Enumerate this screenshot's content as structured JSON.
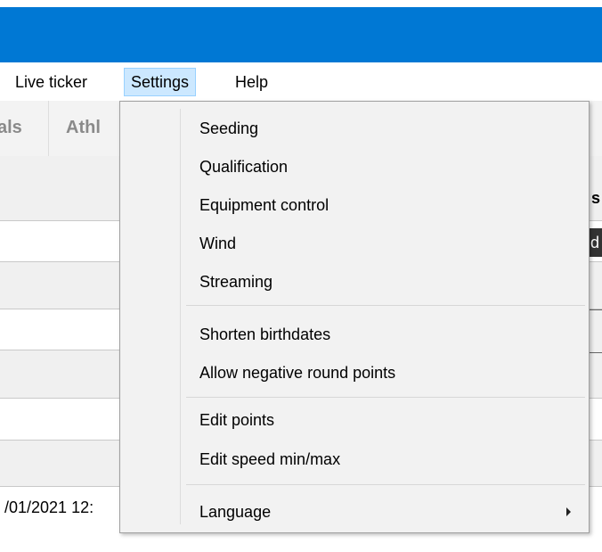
{
  "colors": {
    "titlebar": "#0078d4",
    "menu_active_bg": "#cce8ff",
    "dropdown_bg": "#f2f2f2"
  },
  "menubar": {
    "live_ticker": "Live ticker",
    "settings": "Settings",
    "help": "Help"
  },
  "tabs": {
    "finals_partial": "als",
    "athletes_partial": "Athl"
  },
  "background": {
    "date_partial": "/01/2021 12:",
    "right_letter_1": "s",
    "right_letter_2": "d"
  },
  "settings_menu": {
    "items": [
      "Seeding",
      "Qualification",
      "Equipment control",
      "Wind",
      "Streaming",
      "Shorten birthdates",
      "Allow negative round points",
      "Edit points",
      "Edit speed min/max",
      "Language"
    ],
    "submenu_icon": "chevron-right-icon"
  }
}
